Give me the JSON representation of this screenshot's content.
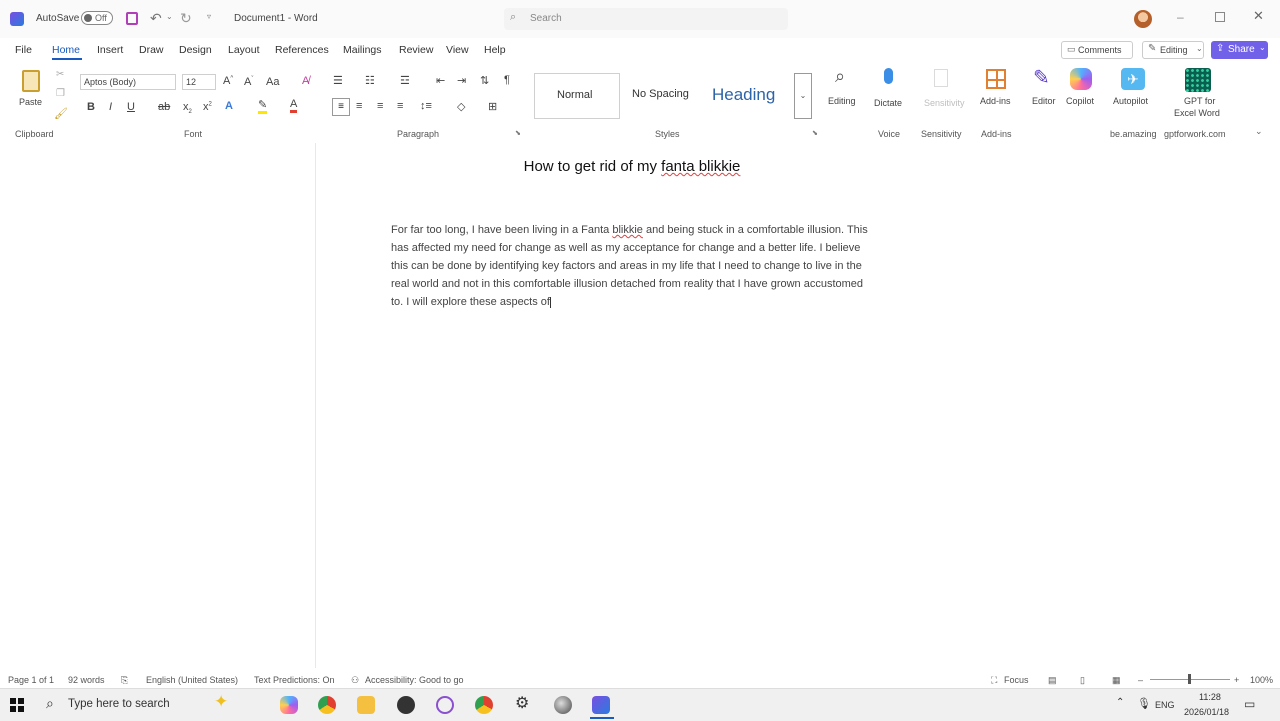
{
  "titlebar": {
    "autosave_label": "AutoSave",
    "autosave_state": "Off",
    "doc_title": "Document1 - Word",
    "search_placeholder": "Search"
  },
  "menu": [
    "File",
    "Home",
    "Insert",
    "Draw",
    "Design",
    "Layout",
    "References",
    "Mailings",
    "Review",
    "View",
    "Help"
  ],
  "right_actions": {
    "comments": "Comments",
    "editing": "Editing",
    "share": "Share"
  },
  "ribbon": {
    "paste": "Paste",
    "font_name": "Aptos (Body)",
    "font_size": "12",
    "styles": {
      "normal": "Normal",
      "nospacing": "No Spacing",
      "heading": "Heading"
    },
    "tools": {
      "editing": "Editing",
      "dictate": "Dictate",
      "sensitivity": "Sensitivity",
      "addins": "Add-ins",
      "editor": "Editor",
      "copilot": "Copilot",
      "autopilot": "Autopilot",
      "gpt_line1": "GPT for",
      "gpt_line2": "Excel Word"
    },
    "groups": {
      "clipboard": "Clipboard",
      "font": "Font",
      "paragraph": "Paragraph",
      "styles": "Styles",
      "voice": "Voice",
      "sensitivity": "Sensitivity",
      "addins": "Add-ins",
      "beamazing": "be.amazing",
      "gptforwork": "gptforwork.com"
    }
  },
  "document": {
    "title_pre": "How to get rid of my ",
    "title_misspelled": "fanta blikkie",
    "body_pre": "For far too long, I have been living in a Fanta ",
    "body_misspelled": "blikkie",
    "body_post": " and being stuck in a comfortable illusion. This has affected my need for change as well as my acceptance for change and a better life. I believe this can be done by identifying key factors and areas in my life that I need to change to live in the real world and not in this comfortable illusion detached from reality that I have grown accustomed to. I will explore these aspects of"
  },
  "statusbar": {
    "page": "Page 1 of 1",
    "words": "92 words",
    "language": "English (United States)",
    "predictions": "Text Predictions: On",
    "accessibility": "Accessibility: Good to go",
    "focus": "Focus",
    "zoom": "100%"
  },
  "taskbar": {
    "search_placeholder": "Type here to search",
    "lang": "ENG",
    "time": "11:28",
    "date": "2026/01/18"
  },
  "colors": {
    "accent": "#185abd",
    "share": "#7160e8",
    "heading": "#2d63a8"
  }
}
